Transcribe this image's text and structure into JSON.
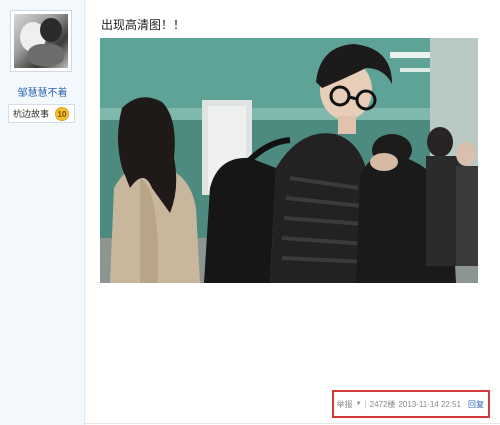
{
  "user": {
    "name": "邹慧慧不着",
    "badge_label": "杭边故事",
    "badge_level": "10"
  },
  "post": {
    "text": "出现高清图！！"
  },
  "footer": {
    "report_label": "举报",
    "floor": "2472楼",
    "timestamp": "2013-11-14 22:51",
    "reply_label": "回复"
  },
  "colors": {
    "link": "#2d64b3",
    "highlight_border": "#d23a3a",
    "sidebar_bg": "#f3f8fd"
  }
}
